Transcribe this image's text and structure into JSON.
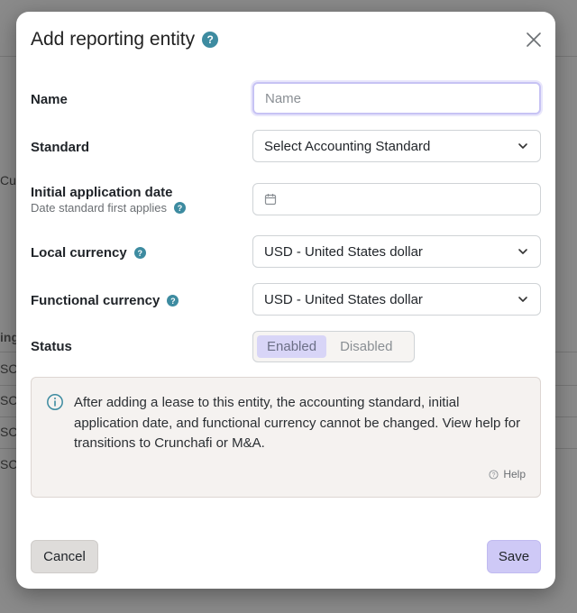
{
  "background": {
    "fragments": [
      "Cus",
      "ing",
      "SC",
      "SC",
      "SC",
      "SC"
    ]
  },
  "modal": {
    "title": "Add reporting entity",
    "title_help_icon": "help-circle-icon",
    "close_icon": "close-icon"
  },
  "form": {
    "name": {
      "label": "Name",
      "value": "",
      "placeholder": "Name"
    },
    "standard": {
      "label": "Standard",
      "value": "Select Accounting Standard"
    },
    "initial_date": {
      "label": "Initial application date",
      "sublabel": "Date standard first applies",
      "value": ""
    },
    "local_currency": {
      "label": "Local currency",
      "value": "USD - United States dollar"
    },
    "functional_currency": {
      "label": "Functional currency",
      "value": "USD - United States dollar"
    },
    "status": {
      "label": "Status",
      "options": [
        "Enabled",
        "Disabled"
      ],
      "selected": "Enabled"
    }
  },
  "info": {
    "icon": "info-circle-icon",
    "text": "After adding a lease to this entity, the accounting standard, initial application date, and functional currency cannot be changed. View help for transitions to Crunchafi or M&A.",
    "help_label": "Help"
  },
  "actions": {
    "cancel_label": "Cancel",
    "save_label": "Save"
  },
  "colors": {
    "help_icon": "#3d8ba0",
    "primary_button": "#cec9f6",
    "segment_active": "#d8d5f7",
    "info_bg": "#f5f2f0"
  }
}
